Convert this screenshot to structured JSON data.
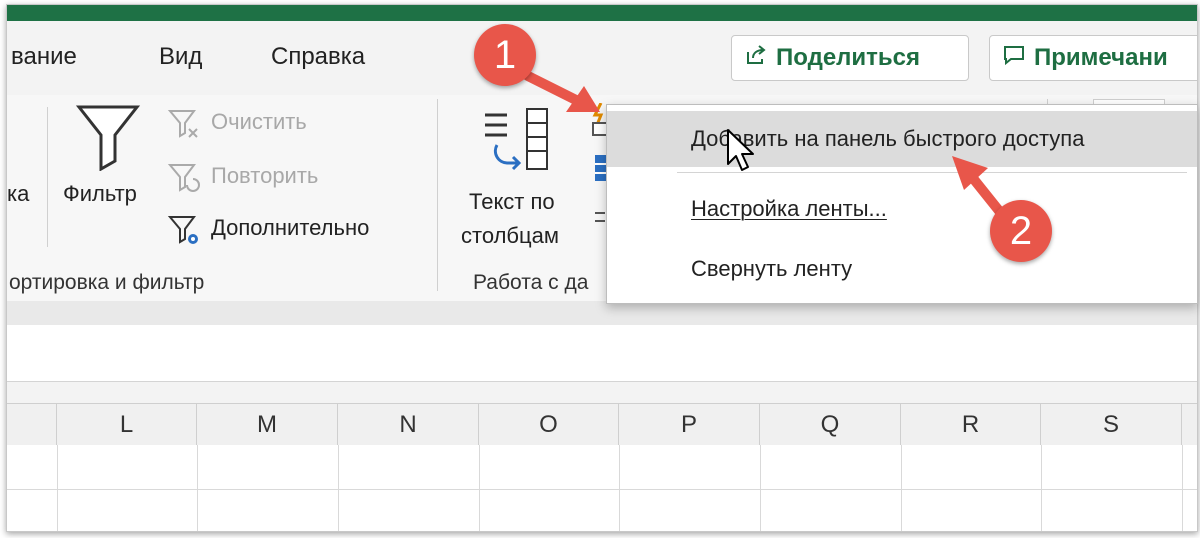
{
  "ribbon_tabs": {
    "partial_tab": "вание",
    "view": "Вид",
    "help": "Справка"
  },
  "top_buttons": {
    "share": "Поделиться",
    "comments": "Примечани"
  },
  "sort_filter_group": {
    "partial_label": "ка",
    "filter": "Фильтр",
    "clear": "Очистить",
    "reapply": "Повторить",
    "advanced": "Дополнительно",
    "group_label": "ортировка и фильтр"
  },
  "data_tools_group": {
    "text_to_columns_line1": "Текст по",
    "text_to_columns_line2": "столбцам",
    "group_label": "Работа с да"
  },
  "columns": [
    "L",
    "M",
    "N",
    "O",
    "P",
    "Q",
    "R",
    "S"
  ],
  "context_menu": {
    "items": [
      {
        "label": "Добавить на панель быстрого доступа",
        "highlighted": true
      },
      {
        "label": "Настройка ленты...",
        "highlighted": false
      },
      {
        "label": "Свернуть ленту",
        "highlighted": false
      }
    ]
  },
  "annotations": {
    "step1": "1",
    "step2": "2",
    "color": "#e8564a"
  },
  "colors": {
    "excel_green": "#1e7145",
    "share_text": "#1e6e42"
  }
}
